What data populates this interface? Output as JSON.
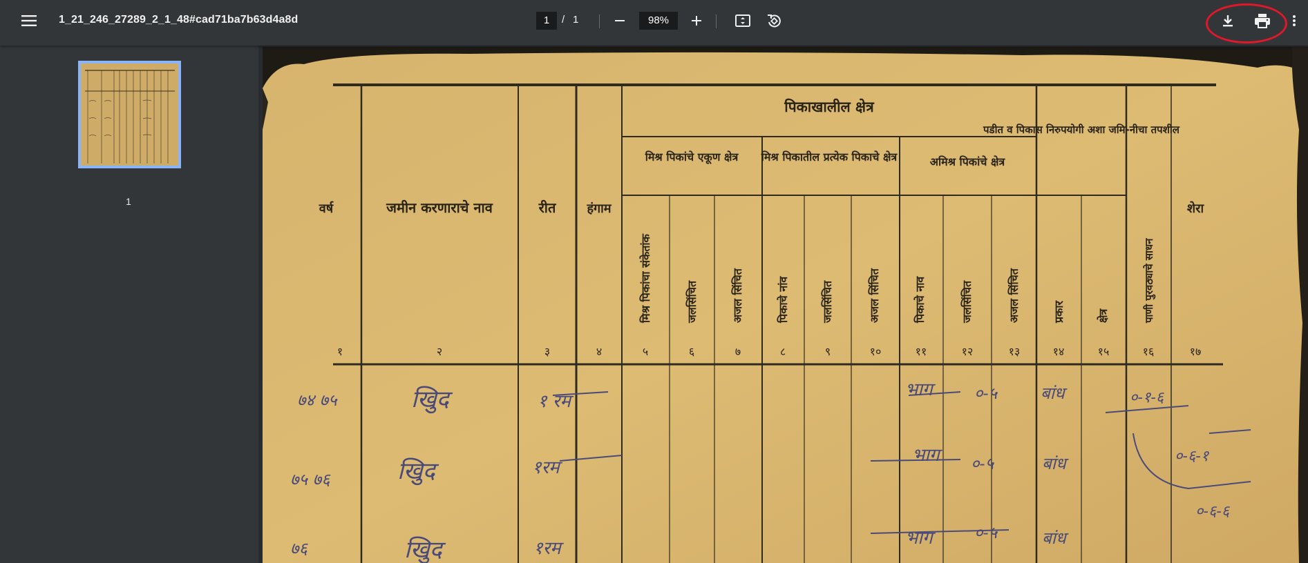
{
  "toolbar": {
    "menu_icon": "hamburger-menu-icon",
    "title": "1_21_246_27289_2_1_48#cad71ba7b63d4a8d",
    "current_page": "1",
    "page_separator": "/",
    "total_pages": "1",
    "zoom": "98%",
    "zoom_out_icon": "minus-icon",
    "zoom_in_icon": "plus-icon",
    "fit_icon": "fit-to-page-icon",
    "rotate_icon": "rotate-counterclockwise-icon",
    "download_icon": "download-icon",
    "print_icon": "print-icon",
    "more_icon": "more-vertical-icon",
    "highlight_color": "#e0182a"
  },
  "sidebar": {
    "thumbnails": [
      {
        "label": "1",
        "selected": true
      }
    ],
    "selected_border_color": "#8ab4f8"
  },
  "document": {
    "header_group": "पिकाखालील क्षेत्र",
    "subgroup_mixed_total": "मिश्र पिकांचे एकूण क्षेत्र",
    "subgroup_mixed_each": "मिश्र पिकातील प्रत्येक पिकाचे क्षेत्र",
    "subgroup_unmixed": "अमिश्र पिकांचे क्षेत्र",
    "fallow_header": "पडीत व पिकास निरुपयोगी अशा जमि-नीचा तपशील",
    "columns": [
      {
        "label": "वर्ष",
        "num": "१"
      },
      {
        "label": "जमीन करणाराचे नाव",
        "num": "२"
      },
      {
        "label": "रीत",
        "num": "३"
      },
      {
        "label": "हंगाम",
        "num": "४"
      },
      {
        "label": "मिश्र पिकांचा संकेतांक",
        "num": "५"
      },
      {
        "label": "जलसिंचित",
        "num": "६"
      },
      {
        "label": "अजल सिंचित",
        "num": "७"
      },
      {
        "label": "पिकाचे नांव",
        "num": "८"
      },
      {
        "label": "जलसिंचित",
        "num": "९"
      },
      {
        "label": "अजल सिंचित",
        "num": "१०"
      },
      {
        "label": "पिकाचे नाव",
        "num": "११"
      },
      {
        "label": "जलसिंचित",
        "num": "१२"
      },
      {
        "label": "अजल सिंचित",
        "num": "१३"
      },
      {
        "label": "प्रकार",
        "num": "१४"
      },
      {
        "label": "क्षेत्र",
        "num": "१५"
      },
      {
        "label": "पाणी पुरवठ्याचे साधन",
        "num": "१६"
      },
      {
        "label": "शेरा",
        "num": "१७"
      }
    ],
    "handwritten_rows": [
      {
        "year": "७४ ७५",
        "name": "खिुद",
        "method": "१ रम",
        "crop": "भाग",
        "area": "०-५",
        "kind": "बांध",
        "note": "०-१-६"
      },
      {
        "year": "७५ ७६",
        "name": "खिुद",
        "method": "१रम",
        "crop": "भाग",
        "area": "०-५",
        "kind": "बांध",
        "note": "०-६-१"
      },
      {
        "year": "७६",
        "name": "खिुद",
        "method": "१रम",
        "crop": "भाग",
        "area": "०-५",
        "kind": "बांध",
        "note": "०-६-६"
      }
    ]
  }
}
